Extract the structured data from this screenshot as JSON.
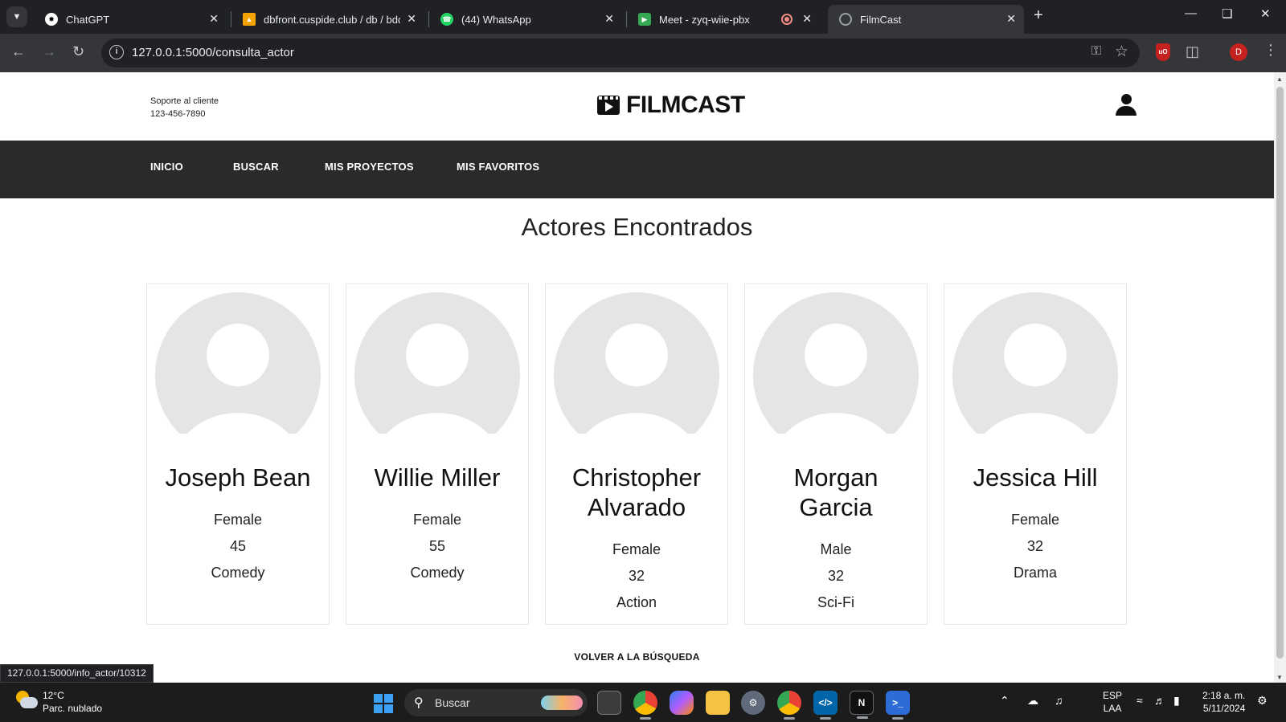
{
  "browser": {
    "tabs": [
      {
        "title": "ChatGPT",
        "active": false
      },
      {
        "title": "dbfront.cuspide.club / db / bdd",
        "active": false
      },
      {
        "title": "(44) WhatsApp",
        "active": false
      },
      {
        "title": "Meet - zyq-wiie-pbx",
        "active": false
      },
      {
        "title": "FilmCast",
        "active": true
      }
    ],
    "url": "127.0.0.1:5000/consulta_actor",
    "profile_initial": "D",
    "status_url": "127.0.0.1:5000/info_actor/10312"
  },
  "site": {
    "support_label": "Soporte al cliente",
    "support_phone": "123-456-7890",
    "brand": "FILMCAST",
    "nav": [
      "INICIO",
      "BUSCAR",
      "MIS PROYECTOS",
      "MIS FAVORITOS"
    ]
  },
  "page": {
    "heading": "Actores Encontrados",
    "actors": [
      {
        "name": "Joseph Bean",
        "gender": "Female",
        "age": "45",
        "genre": "Comedy"
      },
      {
        "name": "Willie Miller",
        "gender": "Female",
        "age": "55",
        "genre": "Comedy"
      },
      {
        "name": "Christopher Alvarado",
        "gender": "Female",
        "age": "32",
        "genre": "Action"
      },
      {
        "name": "Morgan Garcia",
        "gender": "Male",
        "age": "32",
        "genre": "Sci-Fi"
      },
      {
        "name": "Jessica Hill",
        "gender": "Female",
        "age": "32",
        "genre": "Drama"
      }
    ],
    "back_link": "VOLVER A LA BÚSQUEDA"
  },
  "taskbar": {
    "temperature": "12°C",
    "weather": "Parc. nublado",
    "search_label": "Buscar",
    "lang_top": "ESP",
    "lang_bottom": "LAA",
    "time": "2:18 a. m.",
    "date": "5/11/2024"
  },
  "colors": {
    "navbar_bg": "#2b2a28",
    "avatar_gray": "#e5e5e5",
    "browser_dark": "#202124"
  }
}
